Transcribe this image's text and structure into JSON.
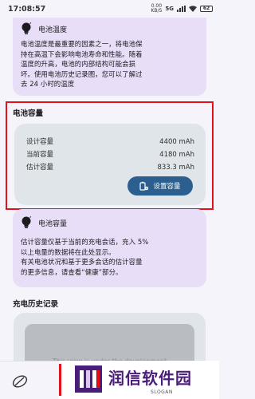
{
  "status_bar": {
    "time": "17:08:57",
    "net_speed": "0.00 KB/S",
    "network": "5G",
    "battery": "62"
  },
  "temperature_card": {
    "title": "电池温度",
    "lines": [
      "电池温度是最重要的因素之一，将电池保",
      "持在高温下会影响电池寿命和性能。随着",
      "温度的升高，电池的内部结构可能会损",
      "坏。使用电池历史记录图，您可以了解过",
      "去 24 小时的温度"
    ]
  },
  "capacity_section": {
    "title": "电池容量",
    "rows": [
      {
        "label": "设计容量",
        "value": "4400 mAh"
      },
      {
        "label": "当前容量",
        "value": "4180 mAh"
      },
      {
        "label": "估计容量",
        "value": "833.3 mAh"
      }
    ],
    "button_label": "设置容量"
  },
  "capacity_info_card": {
    "title": "电池容量",
    "lines": [
      "估计容量仅基于当前的充电会话，充入 5%",
      "以上电量的数据将在此处显示。",
      "有关电池状况和基于更多会话的估计容量",
      "的更多信息，请查看“健康”部分。"
    ]
  },
  "history_section": {
    "title": "充电历史记录",
    "placeholder": "This view is under the development"
  },
  "watermark": {
    "name": "润信软件园",
    "slogan": "SLOGAN"
  },
  "colors": {
    "accent": "#2b5f8f",
    "card_purple": "#e8def8",
    "card_gray": "#e0e5ea",
    "highlight": "#e3111b"
  }
}
